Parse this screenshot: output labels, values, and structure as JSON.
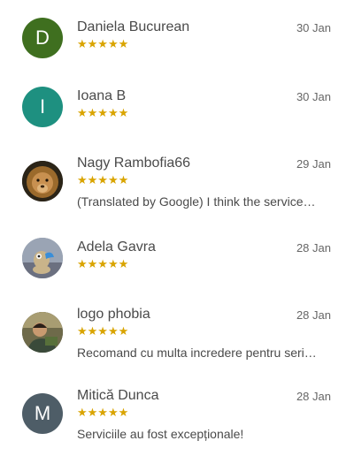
{
  "reviews": [
    {
      "author": "Daniela Bucurean",
      "date": "30 Jan",
      "stars": "★★★★★",
      "rating": 5,
      "avatar_initial": "D",
      "avatar_color": "#3f6f1f",
      "text": ""
    },
    {
      "author": "Ioana B",
      "date": "30 Jan",
      "stars": "★★★★★",
      "rating": 5,
      "avatar_initial": "I",
      "avatar_color": "#1e9080",
      "text": ""
    },
    {
      "author": "Nagy Rambofia66",
      "date": "29 Jan",
      "stars": "★★★★★",
      "rating": 5,
      "avatar_icon": "lion-photo",
      "text": "(Translated by Google) I think the service…"
    },
    {
      "author": "Adela Gavra",
      "date": "28 Jan",
      "stars": "★★★★★",
      "rating": 5,
      "avatar_icon": "cartoon-photo",
      "text": ""
    },
    {
      "author": "logo phobia",
      "date": "28 Jan",
      "stars": "★★★★★",
      "rating": 5,
      "avatar_icon": "person-photo",
      "text": "Recomand cu multa incredere pentru seri…"
    },
    {
      "author": "Mitică Dunca",
      "date": "28 Jan",
      "stars": "★★★★★",
      "rating": 5,
      "avatar_initial": "M",
      "avatar_color": "#4e5d67",
      "text": "Serviciile au fost excepționale!"
    }
  ]
}
